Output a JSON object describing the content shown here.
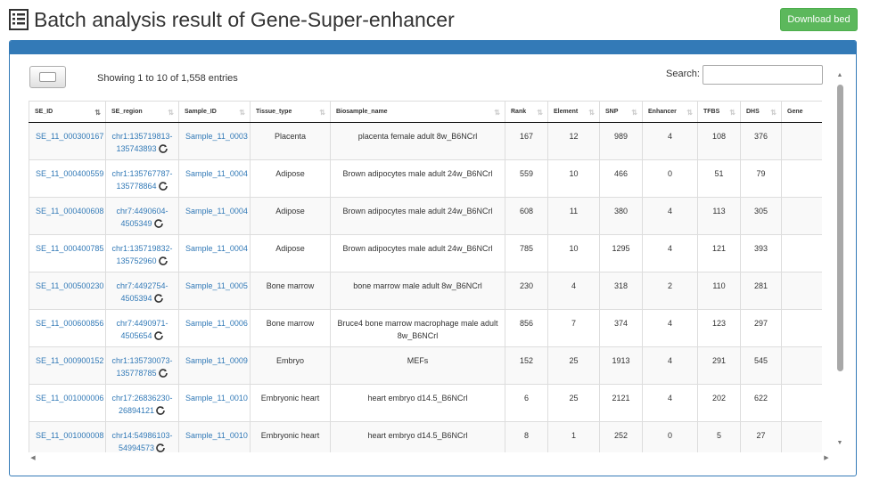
{
  "header": {
    "title": "Batch analysis result of Gene-Super-enhancer",
    "download_label": "Download bed"
  },
  "controls": {
    "info": "Showing 1 to 10 of 1,558 entries",
    "search_label": "Search:",
    "search_value": ""
  },
  "table": {
    "columns": [
      "SE_ID",
      "SE_region",
      "Sample_ID",
      "Tissue_type",
      "Biosample_name",
      "Rank",
      "Element",
      "SNP",
      "Enhancer",
      "TFBS",
      "DHS",
      "Gene"
    ],
    "rows": [
      {
        "se_id": "SE_11_000300167",
        "region_a": "chr1:135719813-",
        "region_b": "135743893",
        "sample": "Sample_11_0003",
        "tissue": "Placenta",
        "biosample": "placenta female adult 8w_B6NCrl",
        "rank": "167",
        "element": "12",
        "snp": "989",
        "enhancer": "4",
        "tfbs": "108",
        "dhs": "376"
      },
      {
        "se_id": "SE_11_000400559",
        "region_a": "chr1:135767787-",
        "region_b": "135778864",
        "sample": "Sample_11_0004",
        "tissue": "Adipose",
        "biosample": "Brown adipocytes male adult 24w_B6NCrl",
        "rank": "559",
        "element": "10",
        "snp": "466",
        "enhancer": "0",
        "tfbs": "51",
        "dhs": "79"
      },
      {
        "se_id": "SE_11_000400608",
        "region_a": "chr7:4490604-",
        "region_b": "4505349",
        "sample": "Sample_11_0004",
        "tissue": "Adipose",
        "biosample": "Brown adipocytes male adult 24w_B6NCrl",
        "rank": "608",
        "element": "11",
        "snp": "380",
        "enhancer": "4",
        "tfbs": "113",
        "dhs": "305"
      },
      {
        "se_id": "SE_11_000400785",
        "region_a": "chr1:135719832-",
        "region_b": "135752960",
        "sample": "Sample_11_0004",
        "tissue": "Adipose",
        "biosample": "Brown adipocytes male adult 24w_B6NCrl",
        "rank": "785",
        "element": "10",
        "snp": "1295",
        "enhancer": "4",
        "tfbs": "121",
        "dhs": "393"
      },
      {
        "se_id": "SE_11_000500230",
        "region_a": "chr7:4492754-",
        "region_b": "4505394",
        "sample": "Sample_11_0005",
        "tissue": "Bone marrow",
        "biosample": "bone marrow male adult 8w_B6NCrl",
        "rank": "230",
        "element": "4",
        "snp": "318",
        "enhancer": "2",
        "tfbs": "110",
        "dhs": "281"
      },
      {
        "se_id": "SE_11_000600856",
        "region_a": "chr7:4490971-",
        "region_b": "4505654",
        "sample": "Sample_11_0006",
        "tissue": "Bone marrow",
        "biosample": "Bruce4 bone marrow macrophage male adult 8w_B6NCrl",
        "rank": "856",
        "element": "7",
        "snp": "374",
        "enhancer": "4",
        "tfbs": "123",
        "dhs": "297"
      },
      {
        "se_id": "SE_11_000900152",
        "region_a": "chr1:135730073-",
        "region_b": "135778785",
        "sample": "Sample_11_0009",
        "tissue": "Embryo",
        "biosample": "MEFs",
        "rank": "152",
        "element": "25",
        "snp": "1913",
        "enhancer": "4",
        "tfbs": "291",
        "dhs": "545"
      },
      {
        "se_id": "SE_11_001000006",
        "region_a": "chr17:26836230-",
        "region_b": "26894121",
        "sample": "Sample_11_0010",
        "tissue": "Embryonic heart",
        "biosample": "heart embryo d14.5_B6NCrl",
        "rank": "6",
        "element": "25",
        "snp": "2121",
        "enhancer": "4",
        "tfbs": "202",
        "dhs": "622"
      },
      {
        "se_id": "SE_11_001000008",
        "region_a": "chr14:54986103-",
        "region_b": "54994573",
        "sample": "Sample_11_0010",
        "tissue": "Embryonic heart",
        "biosample": "heart embryo d14.5_B6NCrl",
        "rank": "8",
        "element": "1",
        "snp": "252",
        "enhancer": "0",
        "tfbs": "5",
        "dhs": "27"
      }
    ]
  },
  "colors": {
    "primary": "#337ab7",
    "success": "#5cb85c"
  },
  "icons": {
    "title": "list-icon",
    "refresh": "refresh-icon"
  }
}
